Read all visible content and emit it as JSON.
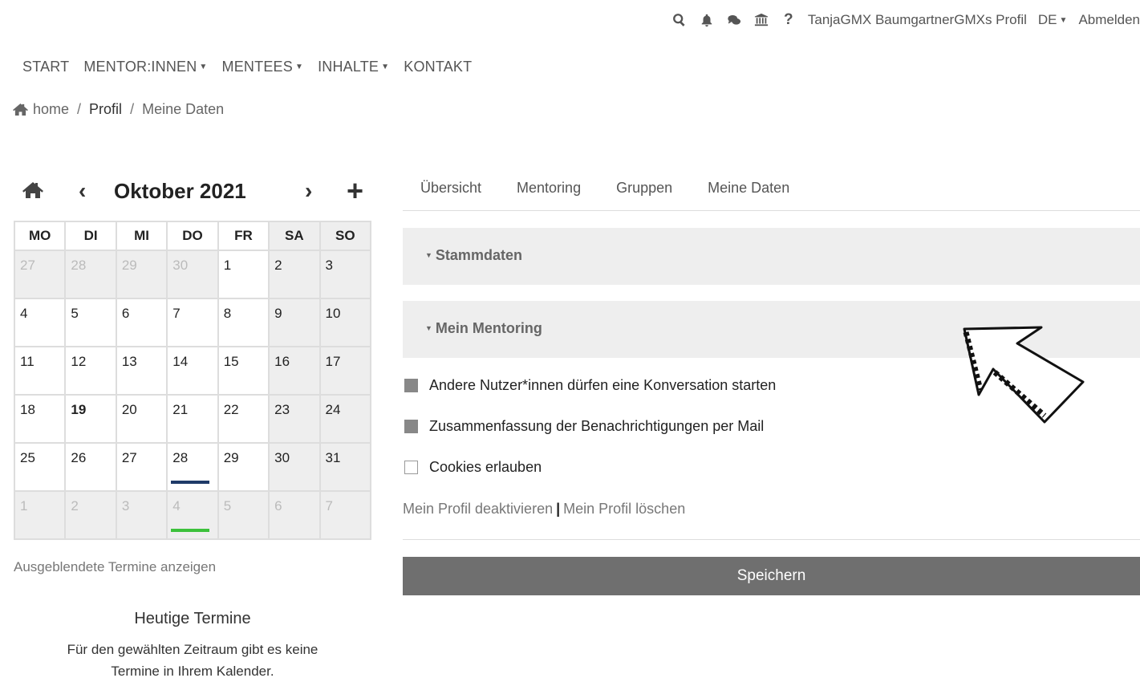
{
  "topbar": {
    "icons": [
      "search-icon",
      "bell-icon",
      "chat-icon",
      "institution-icon",
      "help-icon"
    ],
    "profile_label": "TanjaGMX BaumgartnerGMXs Profil",
    "language": "DE",
    "logout": "Abmelden"
  },
  "nav": {
    "start": "START",
    "mentors": "MENTOR:INNEN",
    "mentees": "MENTEES",
    "content": "INHALTE",
    "contact": "KONTAKT"
  },
  "breadcrumb": {
    "home": "home",
    "profile": "Profil",
    "current": "Meine Daten"
  },
  "calendar": {
    "month_title": "Oktober 2021",
    "prev": "‹",
    "next": "›",
    "add": "+",
    "weekdays": [
      "MO",
      "DI",
      "MI",
      "DO",
      "FR",
      "SA",
      "SO"
    ],
    "weeks": [
      [
        "27",
        "28",
        "29",
        "30",
        "1",
        "2",
        "3"
      ],
      [
        "4",
        "5",
        "6",
        "7",
        "8",
        "9",
        "10"
      ],
      [
        "11",
        "12",
        "13",
        "14",
        "15",
        "16",
        "17"
      ],
      [
        "18",
        "19",
        "20",
        "21",
        "22",
        "23",
        "24"
      ],
      [
        "25",
        "26",
        "27",
        "28",
        "29",
        "30",
        "31"
      ],
      [
        "1",
        "2",
        "3",
        "4",
        "5",
        "6",
        "7"
      ]
    ],
    "today": "19",
    "event_colors": {
      "navy": "#1f3a68",
      "green": "#3cc13b"
    },
    "show_hidden": "Ausgeblendete Termine anzeigen"
  },
  "today_events": {
    "title": "Heutige Termine",
    "text": "Für den gewählten Zeitraum gibt es keine Termine in Ihrem Kalender."
  },
  "tabs": {
    "overview": "Übersicht",
    "mentoring": "Mentoring",
    "groups": "Gruppen",
    "mydata": "Meine Daten"
  },
  "panels": {
    "master": "Stammdaten",
    "my_mentoring": "Mein Mentoring"
  },
  "options": {
    "conversation": "Andere Nutzer*innen dürfen eine Konversation starten",
    "summary": "Zusammenfassung der Benachrichtigungen per Mail",
    "cookies": "Cookies erlauben"
  },
  "links": {
    "deactivate": "Mein Profil deaktivieren",
    "separator": "|",
    "delete": "Mein Profil löschen"
  },
  "save_button": "Speichern"
}
